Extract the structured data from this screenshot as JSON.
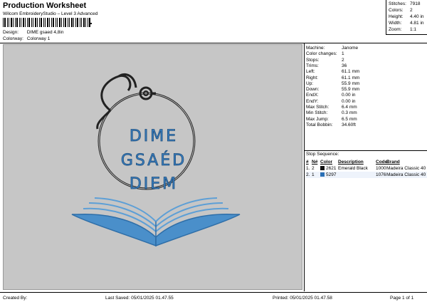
{
  "header": {
    "title": "Production Worksheet",
    "subtitle": "Wilcom EmbroideryStudio – Level 3 Advanced"
  },
  "meta": {
    "design_label": "Design:",
    "design_value": "DIME gsaed 4,8in",
    "colorway_label": "Colorway:",
    "colorway_value": "Colorway 1"
  },
  "stats": [
    {
      "label": "Stitches:",
      "value": "7918"
    },
    {
      "label": "Colors:",
      "value": "2"
    },
    {
      "label": "Height:",
      "value": "4.40 in"
    },
    {
      "label": "Width:",
      "value": "4.81 in"
    },
    {
      "label": "Zoom:",
      "value": "1:1"
    }
  ],
  "design_text": [
    "DIME",
    "GSAÉD",
    "DIEM"
  ],
  "info": [
    {
      "label": "Machine:",
      "value": "Janome"
    },
    {
      "label": "Color changes:",
      "value": "1"
    },
    {
      "label": "Stops:",
      "value": "2"
    },
    {
      "label": "Trims:",
      "value": "36"
    },
    {
      "label": "Left:",
      "value": "61.1 mm"
    },
    {
      "label": "Right:",
      "value": "61.1 mm"
    },
    {
      "label": "Up:",
      "value": "55.9 mm"
    },
    {
      "label": "Down:",
      "value": "55.9 mm"
    },
    {
      "label": "EndX:",
      "value": "0.00 in"
    },
    {
      "label": "EndY:",
      "value": "0.00 in"
    },
    {
      "label": "Max Stitch:",
      "value": "6.4 mm"
    },
    {
      "label": "Min Stitch:",
      "value": "0.3 mm"
    },
    {
      "label": "Max Jump:",
      "value": "6.5 mm"
    },
    {
      "label": "Total Bobbin:",
      "value": "34.60ft"
    }
  ],
  "sequence": {
    "title": "Stop Sequence:",
    "headers": {
      "num": "#",
      "n": "N#",
      "color": "Color",
      "description": "Description",
      "code": "Code",
      "brand": "Brand"
    },
    "rows": [
      {
        "num": "1.",
        "n": "2",
        "swatch": "#111111",
        "code": "2621",
        "description": "Emerald Black",
        "thread_code": "1000",
        "brand": "Madeira Classic 40"
      },
      {
        "num": "2.",
        "n": "1",
        "swatch": "#2a6fb5",
        "code": "5297",
        "description": "",
        "thread_code": "1076",
        "brand": "Madeira Classic 40"
      }
    ]
  },
  "footer": {
    "created": "Created By:",
    "saved": "Last Saved: 05/01/2025 01.47.55",
    "printed": "Printed: 05/01/2025 01.47.58",
    "page": "Page 1 of 1"
  },
  "colors": {
    "canvas_bg": "#c6c6c6",
    "text_blue": "#3b7fc0",
    "book_blue": "#4a8fca",
    "stethoscope": "#222222"
  }
}
